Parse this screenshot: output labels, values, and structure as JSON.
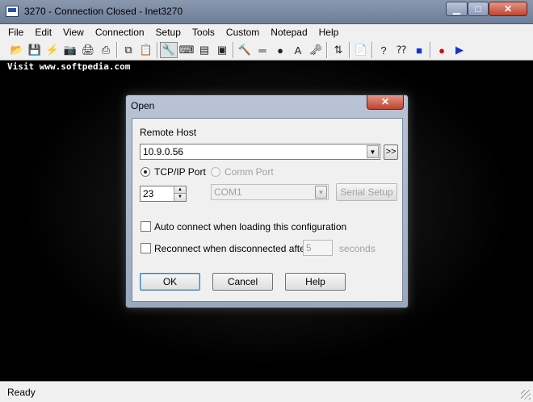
{
  "window": {
    "title": "3270 - Connection Closed - Inet3270"
  },
  "menu": [
    "File",
    "Edit",
    "View",
    "Connection",
    "Setup",
    "Tools",
    "Custom",
    "Notepad",
    "Help"
  ],
  "terminal": {
    "line1": "Visit www.softpedia.com"
  },
  "status": {
    "text": "Ready"
  },
  "dialog": {
    "title": "Open",
    "remote_host_label": "Remote Host",
    "remote_host_value": "10.9.0.56",
    "more_button": ">>",
    "tcpip_label": "TCP/IP Port",
    "comm_label": "Comm Port",
    "port_value": "23",
    "comm_value": "COM1",
    "serial_setup_label": "Serial Setup",
    "auto_connect_label": "Auto connect when loading this configuration",
    "reconnect_label": "Reconnect when disconnected after",
    "reconnect_seconds_value": "5",
    "seconds_label": "seconds",
    "ok_label": "OK",
    "cancel_label": "Cancel",
    "help_label": "Help"
  }
}
